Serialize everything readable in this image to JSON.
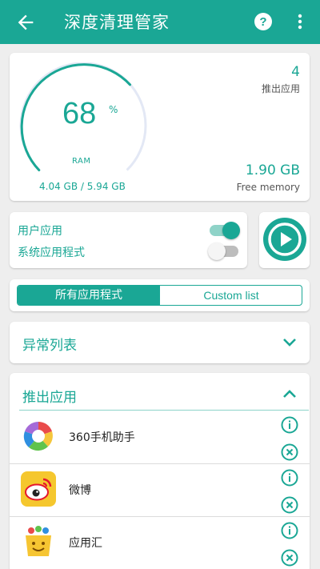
{
  "appbar": {
    "title": "深度清理管家"
  },
  "ram": {
    "percent": "68",
    "percent_sign": "%",
    "label": "RAM",
    "usage": "4.04 GB / 5.94 GB",
    "free_value": "1.90 GB",
    "free_label": "Free memory",
    "fraction": 0.68
  },
  "stopped": {
    "count": "4",
    "label": "推出应用"
  },
  "toggles": [
    {
      "label": "用户应用",
      "on": true
    },
    {
      "label": "系统应用程式",
      "on": false
    }
  ],
  "segments": {
    "all": "所有应用程式",
    "custom": "Custom list"
  },
  "sections": {
    "abnormal": "异常列表",
    "stopped": "推出应用"
  },
  "apps": [
    {
      "name": "360手机助手"
    },
    {
      "name": "微博"
    },
    {
      "name": "应用汇"
    }
  ],
  "colors": {
    "accent": "#1aa795",
    "background": "#eeeeee"
  },
  "icons": [
    "back-arrow-icon",
    "help-icon",
    "more-vert-icon",
    "play-icon",
    "chevron-down-icon",
    "chevron-up-icon",
    "info-icon",
    "close-icon"
  ]
}
